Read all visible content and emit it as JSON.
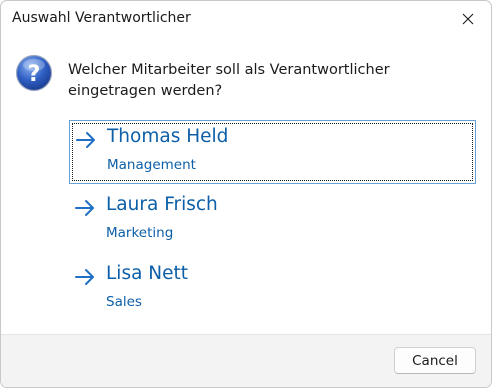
{
  "window": {
    "title": "Auswahl Verantwortlicher",
    "close_icon": "close-icon"
  },
  "dialog": {
    "icon": "question-icon",
    "question": "Welcher Mitarbeiter soll als Verantwortlicher eingetragen werden?",
    "options": [
      {
        "name": "Thomas Held",
        "department": "Management",
        "icon": "arrow-right-icon",
        "focused": true
      },
      {
        "name": "Laura Frisch",
        "department": "Marketing",
        "icon": "arrow-right-icon",
        "focused": false
      },
      {
        "name": "Lisa Nett",
        "department": "Sales",
        "icon": "arrow-right-icon",
        "focused": false
      }
    ]
  },
  "footer": {
    "cancel_label": "Cancel"
  },
  "colors": {
    "link_blue": "#0c5fa8",
    "arrow_blue": "#1f6fc4",
    "footer_bg": "#f3f3f3"
  }
}
